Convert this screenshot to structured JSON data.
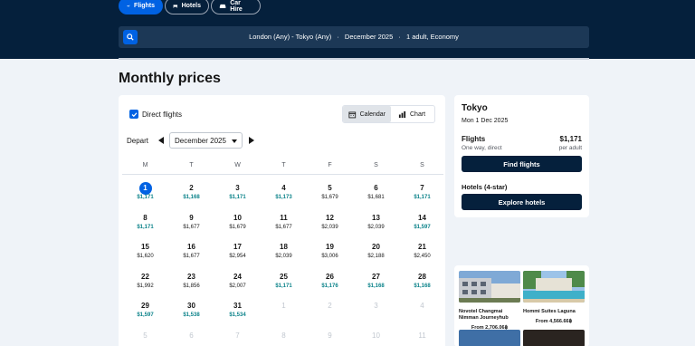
{
  "nav": {
    "flights": "Flights",
    "hotels": "Hotels",
    "car_hire": "Car Hire"
  },
  "search": {
    "route": "London (Any) - Tokyo (Any)",
    "month": "December 2025",
    "travellers": "1 adult, Economy"
  },
  "page_title": "Monthly prices",
  "filters": {
    "direct_flights": "Direct flights",
    "direct_checked": true
  },
  "view_toggle": {
    "calendar": "Calendar",
    "chart": "Chart",
    "active": "Calendar"
  },
  "depart": {
    "label": "Depart",
    "month": "December 2025"
  },
  "weekdays": [
    "M",
    "T",
    "W",
    "T",
    "F",
    "S",
    "S"
  ],
  "calendar": {
    "days": [
      {
        "d": "1",
        "p": "$1,171",
        "low": true,
        "selected": true
      },
      {
        "d": "2",
        "p": "$1,168",
        "low": true
      },
      {
        "d": "3",
        "p": "$1,171",
        "low": true
      },
      {
        "d": "4",
        "p": "$1,173",
        "low": true
      },
      {
        "d": "5",
        "p": "$1,679",
        "low": false
      },
      {
        "d": "6",
        "p": "$1,681",
        "low": false
      },
      {
        "d": "7",
        "p": "$1,171",
        "low": true
      },
      {
        "d": "8",
        "p": "$1,171",
        "low": true
      },
      {
        "d": "9",
        "p": "$1,677",
        "low": false
      },
      {
        "d": "10",
        "p": "$1,679",
        "low": false
      },
      {
        "d": "11",
        "p": "$1,677",
        "low": false
      },
      {
        "d": "12",
        "p": "$2,039",
        "low": false
      },
      {
        "d": "13",
        "p": "$2,039",
        "low": false
      },
      {
        "d": "14",
        "p": "$1,597",
        "low": true
      },
      {
        "d": "15",
        "p": "$1,620",
        "low": false
      },
      {
        "d": "16",
        "p": "$1,677",
        "low": false
      },
      {
        "d": "17",
        "p": "$2,954",
        "low": false
      },
      {
        "d": "18",
        "p": "$2,039",
        "low": false
      },
      {
        "d": "19",
        "p": "$3,006",
        "low": false
      },
      {
        "d": "20",
        "p": "$2,188",
        "low": false
      },
      {
        "d": "21",
        "p": "$2,450",
        "low": false
      },
      {
        "d": "22",
        "p": "$1,992",
        "low": false
      },
      {
        "d": "23",
        "p": "$1,856",
        "low": false
      },
      {
        "d": "24",
        "p": "$2,007",
        "low": false
      },
      {
        "d": "25",
        "p": "$1,171",
        "low": true
      },
      {
        "d": "26",
        "p": "$1,176",
        "low": true
      },
      {
        "d": "27",
        "p": "$1,168",
        "low": true
      },
      {
        "d": "28",
        "p": "$1,168",
        "low": true
      },
      {
        "d": "29",
        "p": "$1,597",
        "low": true
      },
      {
        "d": "30",
        "p": "$1,538",
        "low": true
      },
      {
        "d": "31",
        "p": "$1,534",
        "low": true
      }
    ],
    "next_month_days": [
      "1",
      "2",
      "3",
      "4",
      "5",
      "6",
      "7",
      "8",
      "9",
      "10",
      "11"
    ]
  },
  "summary": {
    "city": "Tokyo",
    "date": "Mon 1 Dec 2025",
    "flights_label": "Flights",
    "flights_price": "$1,171",
    "flights_note": "One way, direct",
    "per_adult": "per adult",
    "find_flights": "Find flights",
    "hotels_label": "Hotels (4-star)",
    "explore_hotels": "Explore hotels"
  },
  "hotels": [
    {
      "name": "Novotel Changmai Nimman Journeyhub",
      "price": "From 2,706.06฿"
    },
    {
      "name": "Hommi Suites Laguna",
      "price": "From 4,566.66฿"
    }
  ],
  "colors": {
    "header": "#05203c",
    "accent": "#0062e3",
    "low_price": "#0c838a"
  }
}
